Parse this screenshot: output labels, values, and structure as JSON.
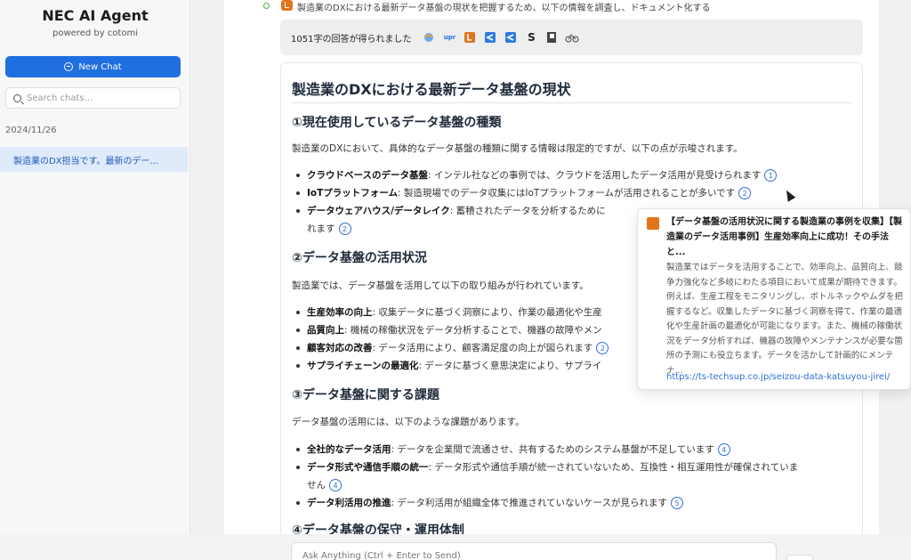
{
  "sidebar": {
    "brand": "NEC AI Agent",
    "brand_sub": "powered by cotomi",
    "new_chat": "New Chat",
    "search_placeholder": "Search chats...",
    "date": "2024/11/26",
    "chat_item": "製造業のDX担当です。最新のデー..."
  },
  "task": {
    "step_text": "製造業のDXにおける最新データ基盤の現状を把握するため、以下の情報を調査し、ドキュメント化する",
    "sources_count": "1051字の回答が得られました"
  },
  "doc": {
    "title": "製造業のDXにおける最新データ基盤の現状",
    "s1": {
      "heading": "①現在使用しているデータ基盤の種類",
      "intro": "製造業のDXにおいて、具体的なデータ基盤の種類に関する情報は限定的ですが、以下の点が示唆されます。",
      "items": [
        {
          "term": "クラウドベースのデータ基盤",
          "text": ": インテル社などの事例では、クラウドを活用したデータ活用が見受けられます",
          "cite": "1"
        },
        {
          "term": "IoTプラットフォーム",
          "text": ": 製造現場でのデータ収集にはIoTプラットフォームが活用されることが多いです",
          "cite": "2"
        },
        {
          "term": "データウェアハウス/データレイク",
          "text": ": 蓄積されたデータを分析するために"
        },
        {
          "term": "",
          "text": "れます",
          "cite": "2"
        }
      ]
    },
    "s2": {
      "heading": "②データ基盤の活用状況",
      "intro": "製造業では、データ基盤を活用して以下の取り組みが行われています。",
      "items": [
        {
          "term": "生産効率の向上",
          "text": ": 収集データに基づく洞察により、作業の最適化や生産"
        },
        {
          "term": "品質向上",
          "text": ": 機械の稼働状況をデータ分析することで、機器の故障やメン"
        },
        {
          "term": "顧客対応の改善",
          "text": ": データ活用により、顧客満足度の向上が図られます",
          "cite": "2"
        },
        {
          "term": "サプライチェーンの最適化",
          "text": ": データに基づく意思決定により、サプライ"
        }
      ]
    },
    "s3": {
      "heading": "③データ基盤に関する課題",
      "intro": "データ基盤の活用には、以下のような課題があります。",
      "items": [
        {
          "term": "全社的なデータ活用",
          "text": ": データを企業間で流通させ、共有するためのシステム基盤が不足しています",
          "cite": "4"
        },
        {
          "term": "データ形式や通信手順の統一",
          "text": ": データ形式や通信手順が統一されていないため、互換性・相互運用性が確保されていま"
        },
        {
          "term": "",
          "text": "せん",
          "cite": "4"
        },
        {
          "term": "データ利活用の推進",
          "text": ": データ利活用が組織全体で推進されていないケースが見られます",
          "cite": "5"
        }
      ]
    },
    "s4": {
      "heading": "④データ基盤の保守・運用体制"
    }
  },
  "popup": {
    "title": "【データ基盤の活用状況に関する製造業の事例を収集】【製造業のデータ活用事例】生産効率向上に成功！その手法と...",
    "body": "製造業ではデータを活用することで、効率向上、品質向上、競争力強化など多岐にわたる項目において成果が期待できます。例えば、生産工程をモニタリングし、ボトルネックやムダを把握するなど。収集したデータに基づく洞察を得て、作業の最適化や生産計画の最適化が可能になります。また、機械の稼働状況をデータ分析すれば、機器の故障やメンテナンスが必要な箇所の予測にも役立ちます。データを活かして計画的にメンテナ...",
    "link": "https://ts-techsup.co.jp/seizou-data-katsuyou-jirei/"
  },
  "input": {
    "placeholder": "Ask Anything (Ctrl + Enter to Send)"
  },
  "colors": {
    "accent": "#1f6fe0",
    "cite": "#2f6fd6",
    "step_icon": "#e2741c",
    "success": "#43b047"
  }
}
